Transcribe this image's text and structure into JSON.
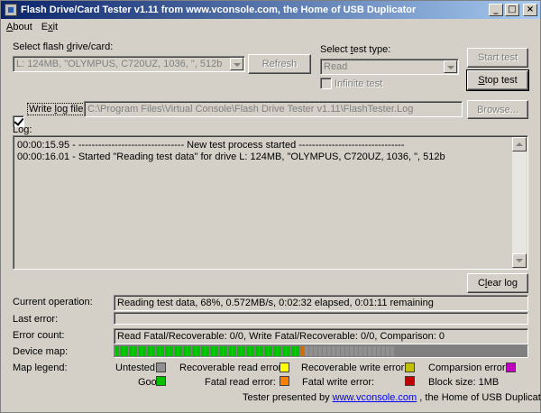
{
  "window": {
    "title": "Flash Drive/Card Tester v1.11 from www.vconsole.com, the Home of USB Duplicator"
  },
  "menu": {
    "about": {
      "mnemonic": "A",
      "rest": "bout"
    },
    "exit": {
      "pre": "E",
      "mnemonic": "x",
      "rest": "it"
    }
  },
  "drive": {
    "label_pre": "Select flash ",
    "label_mnemonic": "d",
    "label_post": "rive/card:",
    "value": "L: 124MB, \"OLYMPUS, C720UZ, 1036, \", 512b",
    "refresh_label": "Refresh"
  },
  "test_type": {
    "label_pre": "Select ",
    "label_mnemonic": "t",
    "label_post": "est type:",
    "value": "Read",
    "infinite_label": "Infinite test"
  },
  "buttons": {
    "start_test": "Start test",
    "stop_test_mnemonic": "S",
    "stop_test_rest": "top test",
    "browse": "Browse...",
    "clear_log_pre": "C",
    "clear_log_mnemonic": "l",
    "clear_log_rest": "ear log"
  },
  "log_file": {
    "label_pre": "Write ",
    "label_mnemonic": "l",
    "label_post": "og file",
    "path": "C:\\Program Files\\Virtual Console\\Flash Drive Tester v1.11\\FlashTester.Log",
    "checked": true
  },
  "log": {
    "label": "Log:",
    "lines": [
      "00:00:15.95 - -------------------------------- New test process started --------------------------------",
      "00:00:16.01 - Started \"Reading test data\" for drive L: 124MB, \"OLYMPUS, C720UZ, 1036, \", 512b"
    ]
  },
  "status": {
    "current_operation_label": "Current operation:",
    "current_operation": "Reading test data, 68%, 0.572MB/s, 0:02:32 elapsed, 0:01:11 remaining",
    "last_error_label": "Last error:",
    "last_error": "",
    "error_count_label": "Error count:",
    "error_count": "Read Fatal/Recoverable: 0/0, Write Fatal/Recoverable: 0/0, Comparison: 0",
    "device_map_label": "Device map:",
    "map_legend_label": "Map legend:"
  },
  "device_map": {
    "total_blocks": 62,
    "good_blocks": 41,
    "current_block": 42,
    "colors": {
      "good": "#00c000",
      "current": "#d07000",
      "untested": "#909090"
    }
  },
  "legend": {
    "untested": {
      "label": "Untested:",
      "color": "#909090"
    },
    "good": {
      "label": "Good:",
      "color": "#00c000"
    },
    "recoverable_read": {
      "label": "Recoverable read error:",
      "color": "#ffff00"
    },
    "fatal_read": {
      "label": "Fatal read error:",
      "color": "#ff8000"
    },
    "recoverable_write": {
      "label": "Recoverable write error:",
      "color": "#c0c000"
    },
    "fatal_write": {
      "label": "Fatal write error:",
      "color": "#c00000"
    },
    "comparison": {
      "label": "Comparsion error:",
      "color": "#c000c0"
    },
    "block_size": "Block size: 1MB"
  },
  "footer": {
    "pre": "Tester presented by ",
    "link": "www.vconsole.com",
    "post": " , the Home of USB Duplicator."
  }
}
